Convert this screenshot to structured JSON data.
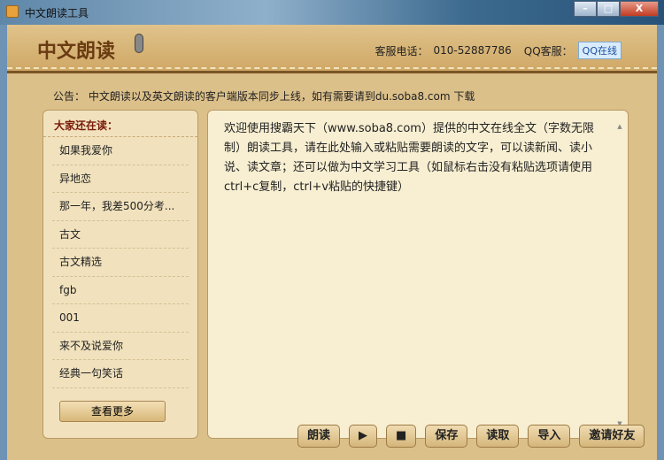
{
  "window": {
    "title": "中文朗读工具",
    "min": "–",
    "max": "□",
    "close": "X"
  },
  "header": {
    "logo": "中文朗读",
    "phone_label": "客服电话：",
    "phone": "010-52887786",
    "qq_label": "QQ客服：",
    "qq_button": "QQ在线"
  },
  "notice": {
    "label": "公告：",
    "text": "中文朗读以及英文朗读的客户端版本同步上线，如有需要请到du.soba8.com 下载"
  },
  "sidebar": {
    "title": "大家还在读：",
    "items": [
      "如果我爱你",
      "异地恋",
      "那一年，我差500分考...",
      "古文",
      "古文精选",
      "fgb",
      "001",
      "来不及说爱你",
      "经典一句笑话"
    ],
    "more": "查看更多"
  },
  "editor": {
    "text": "欢迎使用搜霸天下（www.soba8.com）提供的中文在线全文（字数无限制）朗读工具，请在此处输入或粘贴需要朗读的文字，可以读新闻、读小说、读文章；还可以做为中文学习工具（如鼠标右击没有粘贴选项请使用ctrl+c复制，ctrl+v粘贴的快捷键）"
  },
  "toolbar": {
    "read": "朗读",
    "play": "▶",
    "stop": "■",
    "save": "保存",
    "load": "读取",
    "import": "导入",
    "invite": "邀请好友"
  }
}
